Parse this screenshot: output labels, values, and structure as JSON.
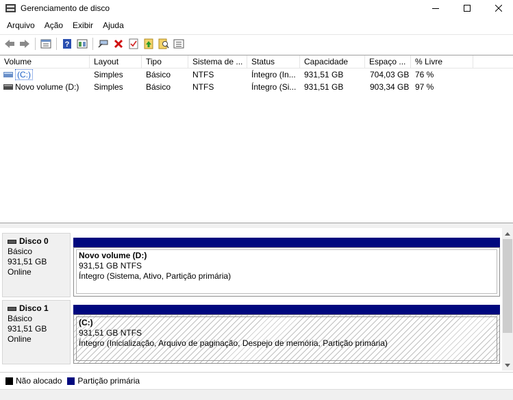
{
  "window": {
    "title": "Gerenciamento de disco"
  },
  "menu": [
    "Arquivo",
    "Ação",
    "Exibir",
    "Ajuda"
  ],
  "toolbar_icons": [
    "back-icon",
    "forward-icon",
    "properties-icon",
    "help-icon",
    "view-icon",
    "connect-icon",
    "delete-icon",
    "check-icon",
    "refresh-icon",
    "search-icon",
    "list-icon"
  ],
  "columns": [
    "Volume",
    "Layout",
    "Tipo",
    "Sistema de ...",
    "Status",
    "Capacidade",
    "Espaço ...",
    "% Livre"
  ],
  "volumes": [
    {
      "volume": "(C:)",
      "layout": "Simples",
      "tipo": "Básico",
      "sistema": "NTFS",
      "status": "Íntegro (In...",
      "capacidade": "931,51 GB",
      "espaco": "704,03 GB",
      "livre": "76 %"
    },
    {
      "volume": "Novo volume (D:)",
      "layout": "Simples",
      "tipo": "Básico",
      "sistema": "NTFS",
      "status": "Íntegro (Si...",
      "capacidade": "931,51 GB",
      "espaco": "903,34 GB",
      "livre": "97 %"
    }
  ],
  "disks": [
    {
      "name": "Disco 0",
      "type": "Básico",
      "size": "931,51 GB",
      "state": "Online",
      "partition": {
        "name": "Novo volume  (D:)",
        "fs": "931,51 GB NTFS",
        "status": "Íntegro (Sistema, Ativo, Partição primária)"
      }
    },
    {
      "name": "Disco 1",
      "type": "Básico",
      "size": "931,51 GB",
      "state": "Online",
      "partition": {
        "name": "(C:)",
        "fs": "931,51 GB NTFS",
        "status": "Íntegro (Inicialização, Arquivo de paginação, Despejo de memória, Partição primária)"
      }
    }
  ],
  "legend": [
    {
      "label": "Não alocado",
      "color": "#000000"
    },
    {
      "label": "Partição primária",
      "color": "#00087e"
    }
  ],
  "colors": {
    "partition_bar": "#00087e",
    "selection": "#1a5fc8"
  }
}
